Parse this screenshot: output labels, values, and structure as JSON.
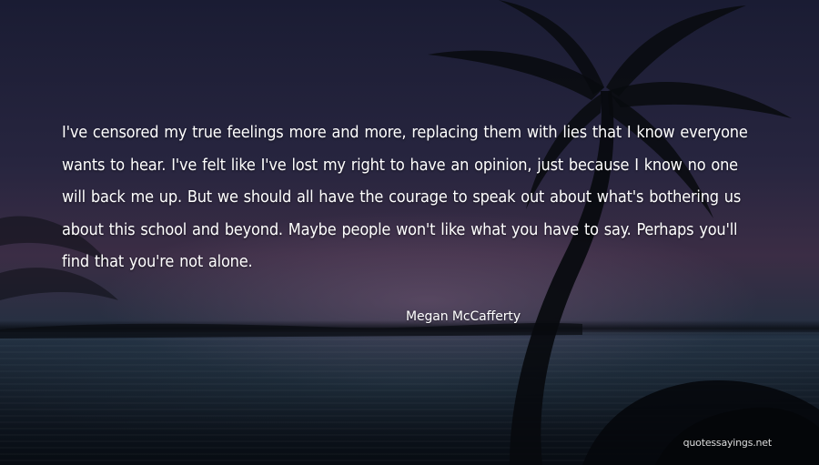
{
  "quote": {
    "text": "I've censored my true feelings more and more, replacing them with lies that I know everyone wants to hear. I've felt like I've lost my right to have an opinion, just because I know no one will back me up. But we should all have the courage to speak out about what's bothering us about this school and beyond. Maybe people won't like what you have to say. Perhaps you'll find that you're not alone.",
    "author": "Megan McCafferty"
  },
  "watermark": "quotessayings.net",
  "colors": {
    "text": "#ffffff",
    "sky_top": "#1a1c33",
    "sky_glow": "#3b2d45",
    "sea": "#0f1620"
  }
}
